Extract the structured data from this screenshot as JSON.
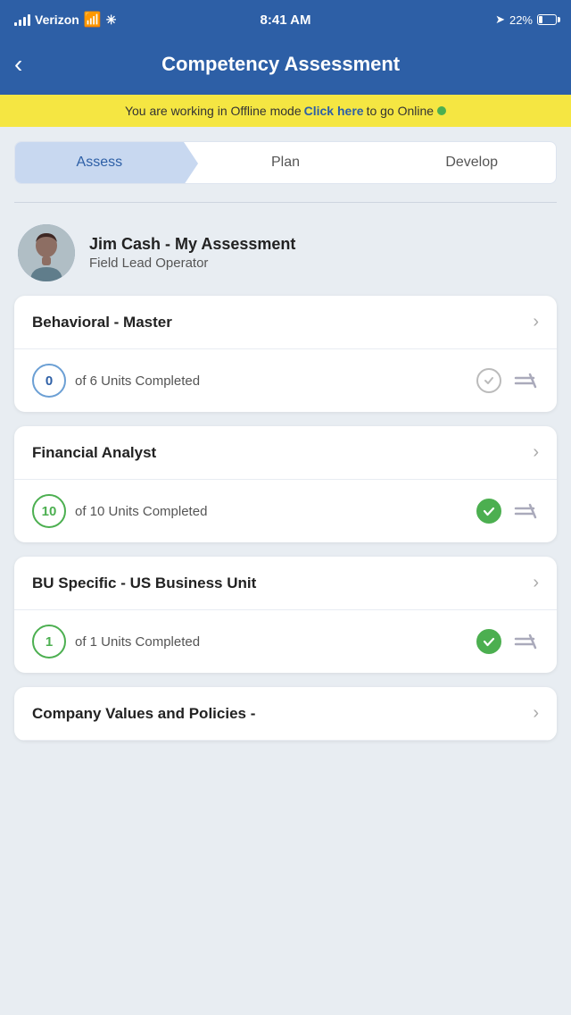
{
  "statusBar": {
    "carrier": "Verizon",
    "time": "8:41 AM",
    "battery": "22%",
    "wifi": true
  },
  "header": {
    "title": "Competency Assessment",
    "backLabel": "‹"
  },
  "offlineBanner": {
    "prefixText": "You are working in Offline mode",
    "clickHereLabel": "Click here",
    "suffixText": "to go Online"
  },
  "tabs": [
    {
      "id": "assess",
      "label": "Assess",
      "active": true
    },
    {
      "id": "plan",
      "label": "Plan",
      "active": false
    },
    {
      "id": "develop",
      "label": "Develop",
      "active": false
    }
  ],
  "profile": {
    "name": "Jim Cash - My Assessment",
    "role": "Field Lead Operator"
  },
  "cards": [
    {
      "id": "behavioral-master",
      "title": "Behavioral - Master",
      "completedUnits": 0,
      "totalUnits": 6,
      "unitText": "of 6 Units Completed",
      "isComplete": false
    },
    {
      "id": "financial-analyst",
      "title": "Financial Analyst",
      "completedUnits": 10,
      "totalUnits": 10,
      "unitText": "of 10 Units Completed",
      "isComplete": true
    },
    {
      "id": "bu-specific",
      "title": "BU Specific - US Business Unit",
      "completedUnits": 1,
      "totalUnits": 1,
      "unitText": "of 1 Units Completed",
      "isComplete": true
    },
    {
      "id": "company-values",
      "title": "Company Values and Policies -",
      "completedUnits": null,
      "totalUnits": null,
      "unitText": "",
      "isComplete": false,
      "partial": true
    }
  ]
}
